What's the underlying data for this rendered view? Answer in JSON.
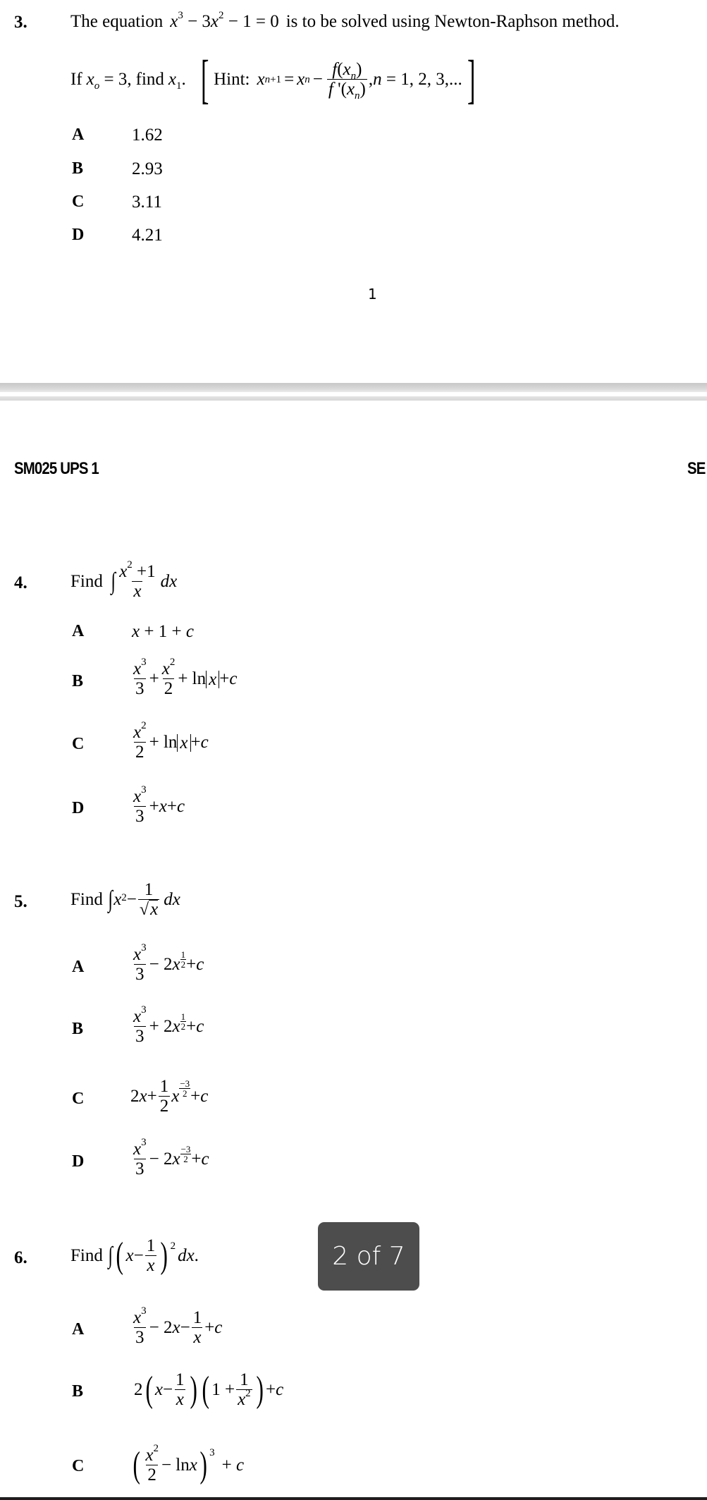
{
  "document": {
    "page_number": "1",
    "header_left": "SM025 UPS 1",
    "header_right_partial": "SE",
    "page_indicator": "2 of 7"
  },
  "questions": [
    {
      "number": "3.",
      "stem_prefix": "The equation",
      "equation": "x³ − 3x² − 1 = 0",
      "stem_suffix": "is to be solved using Newton-Raphson method.",
      "line2_prefix": "If",
      "given": "x₀ = 3,",
      "find_word": "find",
      "find_var": "x₁.",
      "hint_label": "Hint:",
      "hint_formula": "x_{n+1} = x_n − f(x_n)/f'(x_n), n = 1,2,3,...",
      "options": [
        {
          "letter": "A",
          "value": "1.62"
        },
        {
          "letter": "B",
          "value": "2.93"
        },
        {
          "letter": "C",
          "value": "3.11"
        },
        {
          "letter": "D",
          "value": "4.21"
        }
      ]
    },
    {
      "number": "4.",
      "stem_prefix": "Find",
      "integrand": "∫ (x² + 1)/x dx",
      "options": [
        {
          "letter": "A",
          "value": "x + 1 + c"
        },
        {
          "letter": "B",
          "value": "x³/3 + x²/2 + ln|x| + c"
        },
        {
          "letter": "C",
          "value": "x²/2 + ln|x| + c"
        },
        {
          "letter": "D",
          "value": "x³/3 + x + c"
        }
      ]
    },
    {
      "number": "5.",
      "stem_prefix": "Find",
      "integrand": "∫ x² − 1/√x dx",
      "options": [
        {
          "letter": "A",
          "value": "x³/3 − 2x^(1/2) + c"
        },
        {
          "letter": "B",
          "value": "x³/3 + 2x^(1/2) + c"
        },
        {
          "letter": "C",
          "value": "2x + (1/2)x^(−3/2) + c"
        },
        {
          "letter": "D",
          "value": "x³/3 − 2x^(−3/2) + c"
        }
      ]
    },
    {
      "number": "6.",
      "stem_prefix": "Find",
      "integrand": "∫ (x − 1/x)² dx.",
      "options": [
        {
          "letter": "A",
          "value": "x³/3 − 2x − 1/x + c"
        },
        {
          "letter": "B",
          "value": "2(x − 1/x)(1 + 1/x²) + c"
        },
        {
          "letter": "C",
          "value": "(x²/2 − ln x)³ + c"
        }
      ]
    }
  ],
  "colors": {
    "badge_bg": "#4d4d4d",
    "badge_text": "#ffffff",
    "separator": "#d0d0d0"
  }
}
